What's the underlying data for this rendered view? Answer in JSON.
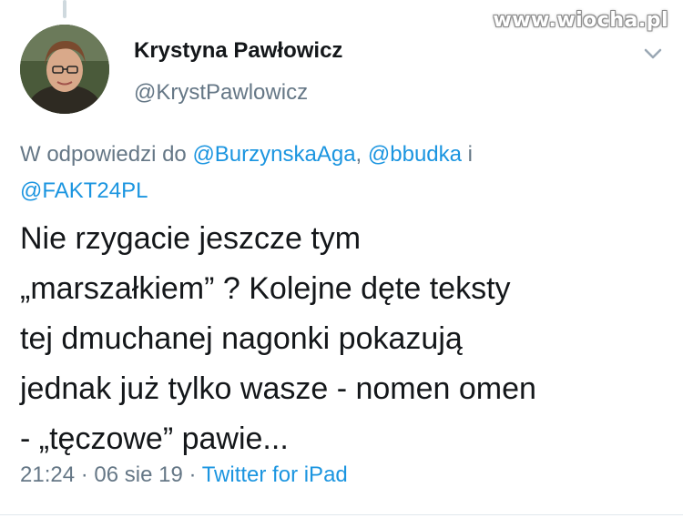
{
  "watermark": "www.wiocha.pl",
  "tweet": {
    "author_name": "Krystyna Pawłowicz",
    "author_handle": "@KrystPawlowicz",
    "reply_prefix": "W odpowiedzi do ",
    "reply_mention_1": "@BurzynskaAga",
    "reply_sep_1": ", ",
    "reply_mention_2": "@bbudka",
    "reply_sep_2": " i ",
    "reply_mention_3": "@FAKT24PL",
    "text": "Nie rzygacie jeszcze tym\n„marszałkiem” ? Kolejne dęte teksty\ntej dmuchanej nagonki pokazują\njednak już tylko wasze - nomen omen\n- „tęczowe” pawie...",
    "time": "21:24",
    "sep1": " · ",
    "date": "06 sie 19",
    "sep2": " · ",
    "source": "Twitter for iPad"
  },
  "icons": {
    "menu": "chevron-down-icon",
    "avatar": "profile-photo"
  },
  "colors": {
    "link": "#1b95e0",
    "secondary": "#657786",
    "text": "#14171a"
  }
}
